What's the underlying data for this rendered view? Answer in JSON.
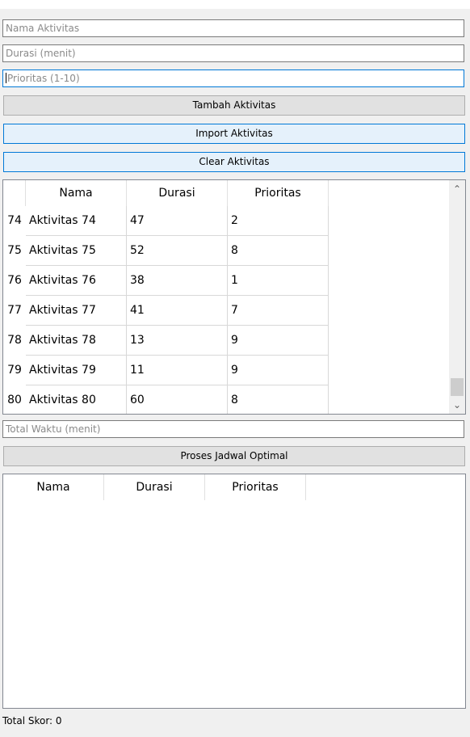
{
  "inputs": {
    "nama_placeholder": "Nama Aktivitas",
    "durasi_placeholder": "Durasi (menit)",
    "prioritas_placeholder": "Prioritas (1-10)",
    "total_waktu_placeholder": "Total Waktu (menit)"
  },
  "buttons": {
    "tambah": "Tambah Aktivitas",
    "import": "Import Aktivitas",
    "clear": "Clear Aktivitas",
    "proses": "Proses Jadwal Optimal"
  },
  "activity_table": {
    "headers": [
      "Nama",
      "Durasi",
      "Prioritas"
    ],
    "rows": [
      {
        "num": "74",
        "nama": "Aktivitas 74",
        "durasi": "47",
        "prioritas": "2"
      },
      {
        "num": "75",
        "nama": "Aktivitas 75",
        "durasi": "52",
        "prioritas": "8"
      },
      {
        "num": "76",
        "nama": "Aktivitas 76",
        "durasi": "38",
        "prioritas": "1"
      },
      {
        "num": "77",
        "nama": "Aktivitas 77",
        "durasi": "41",
        "prioritas": "7"
      },
      {
        "num": "78",
        "nama": "Aktivitas 78",
        "durasi": "13",
        "prioritas": "9"
      },
      {
        "num": "79",
        "nama": "Aktivitas 79",
        "durasi": "11",
        "prioritas": "9"
      },
      {
        "num": "80",
        "nama": "Aktivitas 80",
        "durasi": "60",
        "prioritas": "8"
      }
    ],
    "scroll_position": 1.0
  },
  "result_table": {
    "headers": [
      "Nama",
      "Durasi",
      "Prioritas"
    ]
  },
  "status": {
    "total_skor": "Total Skor: 0"
  }
}
